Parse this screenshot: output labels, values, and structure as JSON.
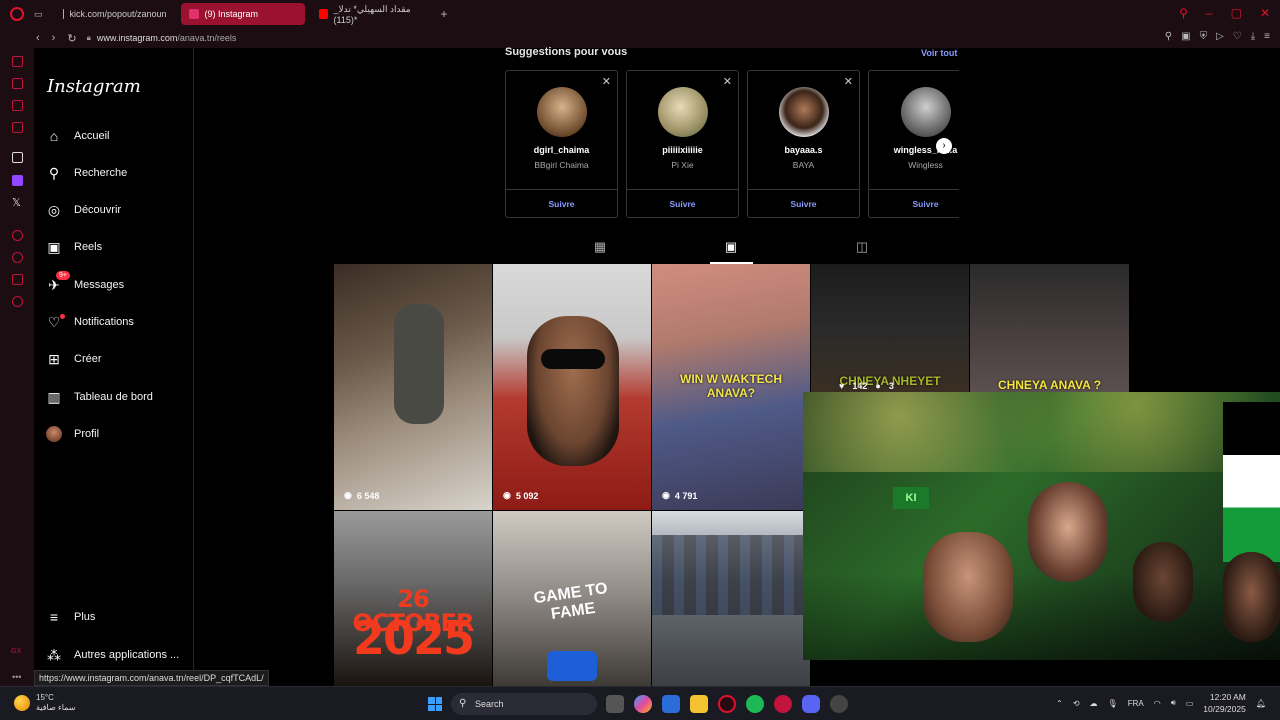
{
  "browser": {
    "tabs": [
      {
        "label": "kick.com/popout/zanoun",
        "color": "#53fc18"
      },
      {
        "label": "(9) Instagram",
        "color": "#e1306c",
        "active": true
      },
      {
        "label": "مقداد السهيلي* تدلا_ (115)*",
        "color": "#ff0000"
      }
    ],
    "new_tab": "+",
    "nav": {
      "back": "‹",
      "forward": "›",
      "reload": "↻"
    },
    "url_host": "www.instagram.com",
    "url_path": "/anava.tn/reels"
  },
  "ig_nav": {
    "logo": "Instagram",
    "items": [
      {
        "label": "Accueil",
        "icon": "home-icon",
        "glyph": "⌂"
      },
      {
        "label": "Recherche",
        "icon": "search-icon",
        "glyph": "⚲"
      },
      {
        "label": "Découvrir",
        "icon": "compass-icon",
        "glyph": "◎"
      },
      {
        "label": "Reels",
        "icon": "reels-icon",
        "glyph": "▣"
      },
      {
        "label": "Messages",
        "icon": "messenger-icon",
        "glyph": "✈",
        "badge": "9+"
      },
      {
        "label": "Notifications",
        "icon": "heart-icon",
        "glyph": "♡",
        "dot": true
      },
      {
        "label": "Créer",
        "icon": "plus-square-icon",
        "glyph": "⊞"
      },
      {
        "label": "Tableau de bord",
        "icon": "dashboard-icon",
        "glyph": "▥"
      },
      {
        "label": "Profil",
        "icon": "profile-avatar-icon"
      }
    ],
    "more": {
      "label": "Plus",
      "glyph": "≡"
    },
    "apps": {
      "label": "Autres applications ...",
      "glyph": "⁂"
    }
  },
  "suggestions": {
    "title": "Suggestions pour vous",
    "see_all": "Voir tout",
    "follow_label": "Suivre",
    "cards": [
      {
        "username": "dgirl_chaima",
        "name": "BBgirl Chaima"
      },
      {
        "username": "piiiiixiiiiie",
        "name": "Pi Xie"
      },
      {
        "username": "bayaaa.s",
        "name": "BAYA"
      },
      {
        "username": "wingless_m...a",
        "name": "Wingless"
      }
    ]
  },
  "profile_tabs": [
    "grid-icon",
    "reels-icon",
    "tagged-icon"
  ],
  "reels": [
    {
      "views": "6 548"
    },
    {
      "views": "5 092"
    },
    {
      "views": "4 791",
      "text": "WIN W WAKTECH ANAVA?"
    },
    {
      "likes": "142",
      "comments": "3",
      "text": "CHNEYA NHEYET"
    },
    {
      "text": "CHNEYA ANAVA ?"
    },
    {
      "text_line1": "26 OCTOBER",
      "text_line2": "2025"
    },
    {
      "text": "GAME TO FAME"
    },
    {}
  ],
  "status_url": "https://www.instagram.com/anava.tn/reel/DP_cqfTCAdL/",
  "taskbar": {
    "temp": "15°C",
    "weather": "سماء صافية",
    "search": "Search",
    "lang": "FRA",
    "time": "12:20 AM",
    "date": "10/29/2025"
  }
}
